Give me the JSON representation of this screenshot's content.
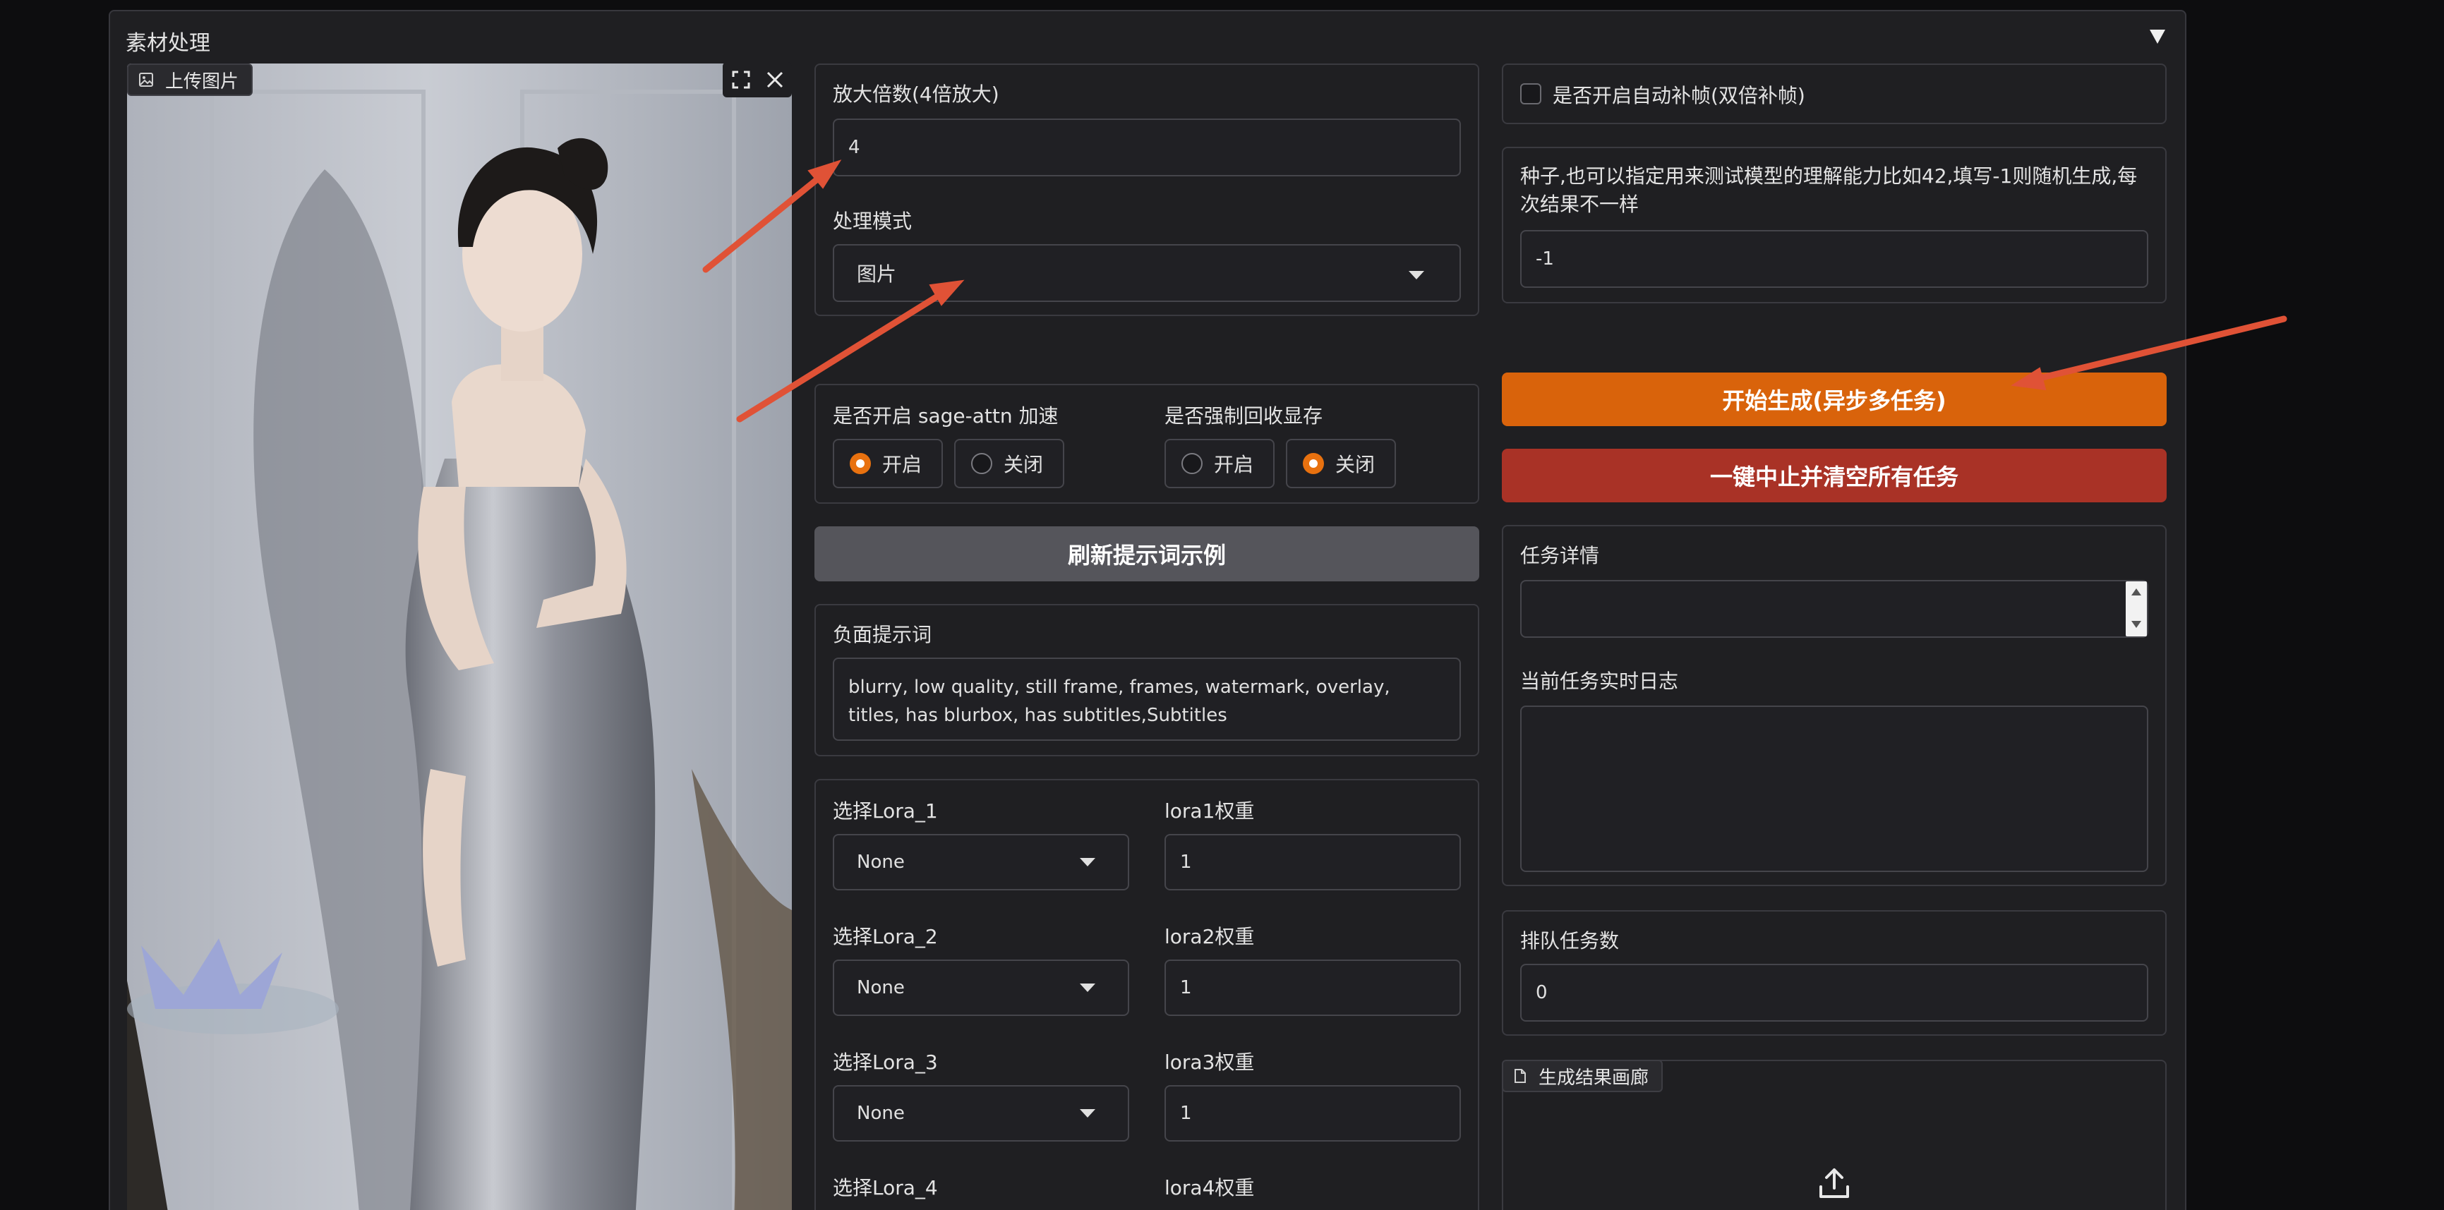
{
  "accordion": {
    "title": "素材处理",
    "toggle_icon": "triangle-down-icon"
  },
  "image_upload": {
    "label": "上传图片",
    "photo_description": "woman in silver satin dress",
    "fullscreen_icon": "expand-icon",
    "close_icon": "close-icon"
  },
  "upscale": {
    "label": "放大倍数(4倍放大)",
    "value": "4",
    "mode_label": "处理模式",
    "mode_value": "图片"
  },
  "sage_attn": {
    "label": "是否开启 sage-attn 加速",
    "options": [
      "开启",
      "关闭"
    ],
    "selected": "开启"
  },
  "vram": {
    "label": "是否强制回收显存",
    "options": [
      "开启",
      "关闭"
    ],
    "selected": "关闭"
  },
  "refresh_button": "刷新提示词示例",
  "negative_prompt": {
    "label": "负面提示词",
    "value": "blurry, low quality, still frame, frames, watermark, overlay, titles, has blurbox, has subtitles,Subtitles"
  },
  "lora": [
    {
      "select_label": "选择Lora_1",
      "select_value": "None",
      "weight_label": "lora1权重",
      "weight_value": "1"
    },
    {
      "select_label": "选择Lora_2",
      "select_value": "None",
      "weight_label": "lora2权重",
      "weight_value": "1"
    },
    {
      "select_label": "选择Lora_3",
      "select_value": "None",
      "weight_label": "lora3权重",
      "weight_value": "1"
    },
    {
      "select_label": "选择Lora_4",
      "select_value": "",
      "weight_label": "lora4权重",
      "weight_value": ""
    }
  ],
  "interpolation": {
    "label": "是否开启自动补帧(双倍补帧)",
    "checked": false
  },
  "seed": {
    "label": "种子,也可以指定用来测试模型的理解能力比如42,填写-1则随机生成,每次结果不一样",
    "value": "-1"
  },
  "start_button": "开始生成(异步多任务)",
  "stop_button": "一键中止并清空所有任务",
  "task_details": {
    "label": "任务详情",
    "value": ""
  },
  "task_log": {
    "label": "当前任务实时日志",
    "value": ""
  },
  "queue": {
    "label": "排队任务数",
    "value": "0"
  },
  "gallery": {
    "label": "生成结果画廊",
    "upload_icon": "upload-icon"
  },
  "colors": {
    "accent_orange": "#d9630b",
    "stop_red": "#a93226",
    "refresh_gray": "#55555b",
    "annotation_arrow": "#e05236"
  }
}
